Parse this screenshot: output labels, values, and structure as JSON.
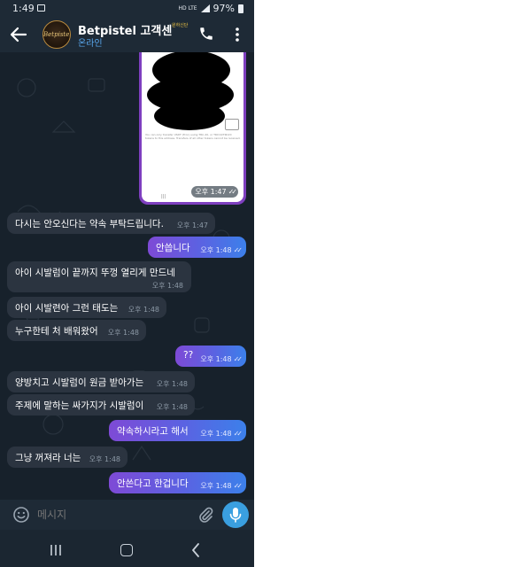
{
  "status_bar": {
    "time": "1:49",
    "network": "HD LTE",
    "battery": "97%"
  },
  "header": {
    "title": "Betpistel 고객센터",
    "badge": "원하신단",
    "subtitle": "온라인",
    "avatar_text": "Betpistel"
  },
  "photo_message": {
    "fine_print": "You can only transfer USDT (Tron) using TRC-20, or TRC10/TRC20 tokens to this address. Transfers of all other tokens cannot be received.",
    "time": "오후 1:47"
  },
  "messages": [
    {
      "direction": "in",
      "text": "다시는 안오신다는 약속 부탁드립니다.",
      "time": "오후 1:47"
    },
    {
      "direction": "out",
      "text": "안씁니다",
      "time": "오후 1:48"
    },
    {
      "direction": "in",
      "text": "아이 시발럼이 끝까지 뚜껑 열리게 만드네",
      "time": "오후 1:48"
    },
    {
      "direction": "in",
      "text": "아이 시발련아 그런 태도는",
      "time": "오후 1:48"
    },
    {
      "direction": "in",
      "text": "누구한테 처 배워왔어",
      "time": "오후 1:48"
    },
    {
      "direction": "out",
      "text": "??",
      "time": "오후 1:48"
    },
    {
      "direction": "in",
      "text": "양방치고 시발럼이 원금 받아가는",
      "time": "오후 1:48"
    },
    {
      "direction": "in",
      "text": "주제에 말하는 싸가지가 시발럼이",
      "time": "오후 1:48"
    },
    {
      "direction": "out",
      "text": "약속하시라고 해서",
      "time": "오후 1:48"
    },
    {
      "direction": "in",
      "text": "그냥 꺼져라 너는",
      "time": "오후 1:48"
    },
    {
      "direction": "out",
      "text": "안쓴다고 한겁니다",
      "time": "오후 1:48"
    }
  ],
  "composer": {
    "placeholder": "메시지"
  },
  "icons": {
    "back": "arrow-left-icon",
    "call": "phone-icon",
    "more": "more-vertical-icon",
    "emoji": "smile-icon",
    "attach": "paperclip-icon",
    "mic": "microphone-icon"
  },
  "colors": {
    "header_bg": "#1e2a36",
    "chat_bg": "#17212b",
    "incoming_bubble": "#2b3440",
    "outgoing_gradient_start": "#7e4ad6",
    "outgoing_gradient_end": "#3c80ea",
    "online_status": "#5aa9f0",
    "mic_button": "#3a9fe0"
  }
}
